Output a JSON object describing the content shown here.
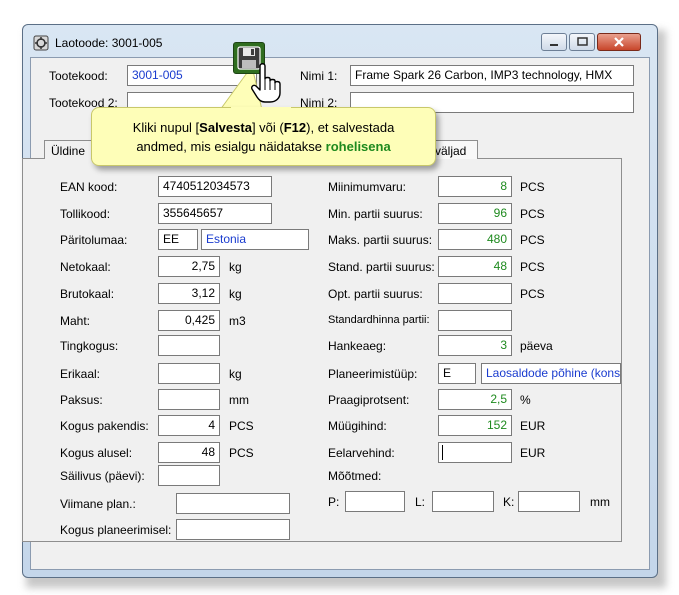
{
  "window": {
    "title": "Laotoode: 3001-005"
  },
  "header": {
    "tootekood_label": "Tootekood:",
    "tootekood_value": "3001-005",
    "tootekood2_label": "Tootekood 2:",
    "nimi1_label": "Nimi 1:",
    "nimi1_value": "Frame Spark 26 Carbon, IMP3 technology, HMX",
    "nimi2_label": "Nimi 2:"
  },
  "tabs": {
    "first": "Üldine",
    "last": "väljad"
  },
  "tooltip": {
    "pre1": "Kliki nupul [",
    "bold1": "Salvesta",
    "mid1": "] või (",
    "bold2": "F12",
    "post1": "), et salvestada",
    "pre2": "andmed, mis esialgu näidatakse ",
    "green": "rohelisena"
  },
  "left": {
    "ean_label": "EAN kood:",
    "ean_value": "4740512034573",
    "tolli_label": "Tollikood:",
    "tolli_value": "355645657",
    "pari_label": "Päritolumaa:",
    "pari_code": "EE",
    "pari_name": "Estonia",
    "neto_label": "Netokaal:",
    "neto_value": "2,75",
    "neto_unit": "kg",
    "bruto_label": "Brutokaal:",
    "bruto_value": "3,12",
    "bruto_unit": "kg",
    "maht_label": "Maht:",
    "maht_value": "0,425",
    "maht_unit": "m3",
    "ting_label": "Tingkogus:",
    "eri_label": "Erikaal:",
    "eri_unit": "kg",
    "paksus_label": "Paksus:",
    "paksus_unit": "mm",
    "pak_label": "Kogus pakendis:",
    "pak_value": "4",
    "pak_unit": "PCS",
    "alus_label": "Kogus alusel:",
    "alus_value": "48",
    "alus_unit": "PCS",
    "sailivus_label": "Säilivus (päevi):",
    "viimane_label": "Viimane plan.:",
    "kogplan_label": "Kogus planeerimisel:"
  },
  "right": {
    "min_label": "Miinimumvaru:",
    "min_value": "8",
    "min_unit": "PCS",
    "minp_label": "Min. partii suurus:",
    "minp_value": "96",
    "minp_unit": "PCS",
    "maksp_label": "Maks. partii suurus:",
    "maksp_value": "480",
    "maksp_unit": "PCS",
    "stand_label": "Stand. partii suurus:",
    "stand_value": "48",
    "stand_unit": "PCS",
    "opt_label": "Opt. partii suurus:",
    "opt_unit": "PCS",
    "stdh_label": "Standardhinna partii:",
    "hank_label": "Hankeaeg:",
    "hank_value": "3",
    "hank_unit": "päeva",
    "plan_label": "Planeerimistüüp:",
    "plan_code": "E",
    "plan_name": "Laosaldode põhine (konse",
    "praak_label": "Praagiprotsent:",
    "praak_value": "2,5",
    "praak_unit": "%",
    "muug_label": "Müügihind:",
    "muug_value": "152",
    "muug_unit": "EUR",
    "eel_label": "Eelarvehind:",
    "eel_unit": "EUR",
    "mootmed_label": "Mõõtmed:",
    "p_label": "P:",
    "l_label": "L:",
    "k_label": "K:",
    "mm_unit": "mm"
  },
  "colors": {
    "green": "#1e8a1e",
    "blue": "#1a3ccf",
    "tooltip_bg": "#fefeb8"
  },
  "icons": {
    "save": "floppy-disk-icon",
    "cursor": "hand-pointer-icon"
  }
}
